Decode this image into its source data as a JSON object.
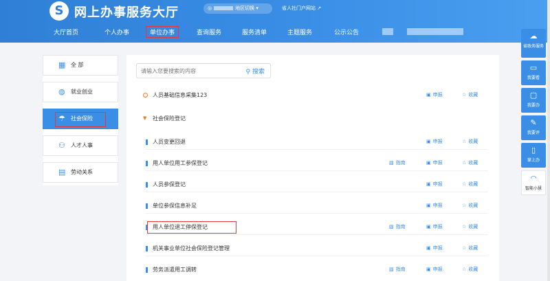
{
  "header": {
    "logo_glyph": "S",
    "title": "网上办事服务大厅",
    "region_switch": "地区切换",
    "portal_link": "省人社门户网站"
  },
  "nav": {
    "items": [
      {
        "label": "大厅首页"
      },
      {
        "label": "个人办事"
      },
      {
        "label": "单位办事"
      },
      {
        "label": "查询服务"
      },
      {
        "label": "服务清单"
      },
      {
        "label": "主题服务"
      },
      {
        "label": "公示公告"
      }
    ]
  },
  "sidebar": {
    "items": [
      {
        "label": "全 部",
        "icon": "grid-icon"
      },
      {
        "label": "就业创业",
        "icon": "briefcase-icon"
      },
      {
        "label": "社会保险",
        "icon": "umbrella-icon"
      },
      {
        "label": "人才人事",
        "icon": "people-icon"
      },
      {
        "label": "劳动关系",
        "icon": "document-icon"
      }
    ]
  },
  "search": {
    "placeholder": "请输入您要搜索的内容",
    "button_label": "搜索"
  },
  "actions": {
    "guide": "指南",
    "apply": "申报",
    "favorite": "收藏"
  },
  "list": {
    "top_item": "人员基础信息采集123",
    "group_title": "社会保险登记",
    "items": [
      {
        "label": "人员变更回退",
        "has_guide": false
      },
      {
        "label": "用人单位用工参保登记",
        "has_guide": true
      },
      {
        "label": "人员参保登记",
        "has_guide": false
      },
      {
        "label": "单位参保信息补足",
        "has_guide": false
      },
      {
        "label": "用人单位退工停保登记",
        "has_guide": true
      },
      {
        "label": "机关事业单位社会保险登记管理",
        "has_guide": false
      },
      {
        "label": "劳务派遣用工调转",
        "has_guide": true
      }
    ]
  },
  "rail": {
    "items": [
      {
        "label": "省政务服务",
        "icon": "cloud-icon"
      },
      {
        "label": "我要看",
        "icon": "book-icon"
      },
      {
        "label": "我要办",
        "icon": "monitor-icon"
      },
      {
        "label": "我要评",
        "icon": "edit-icon"
      },
      {
        "label": "掌上办",
        "icon": "phone-icon"
      },
      {
        "label": "智能小慧",
        "icon": "headset-icon"
      }
    ]
  },
  "colors": {
    "primary": "#3a8ee6",
    "highlight": "#e53935",
    "accent": "#f07a1a"
  }
}
